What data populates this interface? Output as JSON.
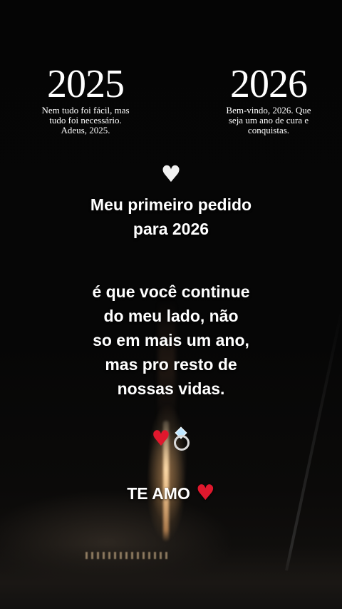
{
  "left_year": {
    "year": "2025",
    "caption": "Nem tudo foi fácil, mas\ntudo foi necessário.\nAdeus, 2025."
  },
  "right_year": {
    "year": "2026",
    "caption": "Bem-vindo, 2026. Que\nseja um ano de cura e\nconquistas."
  },
  "icons": {
    "top_heart": "white-heart-icon",
    "top_heart_glyph": "♥",
    "top_heart_color": "#f2f2f2",
    "emoji_heart": "red-heart-icon",
    "emoji_heart_glyph": "♥",
    "emoji_heart_color": "#e0182d",
    "ring": "ring-icon"
  },
  "message": {
    "line_block_1": "Meu primeiro pedido\npara 2026",
    "line_block_2": "é que você continue\ndo meu lado, não\nso em mais um ano,\nmas pro resto de\nnossas vidas."
  },
  "closing": {
    "text": "TE AMO",
    "heart_glyph": "♥"
  }
}
